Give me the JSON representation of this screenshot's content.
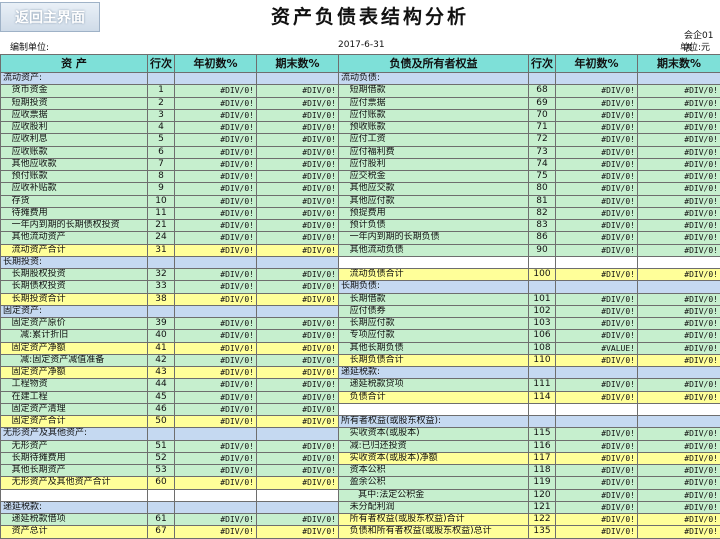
{
  "nav": {
    "back_label": "返回主界面"
  },
  "header": {
    "title": "资产负债表结构分析",
    "form_code": "会企01表",
    "unit_label": "编制单位:",
    "date": "2017-6-31",
    "currency_unit": "单位:元"
  },
  "columns": [
    "资  产",
    "行次",
    "年初数%",
    "期末数%",
    "负债及所有者权益",
    "行次",
    "年初数%",
    "期末数%"
  ],
  "colors": {
    "header": "#7ee0d8",
    "row_green": "#c6efce",
    "row_yellow": "#ffff99",
    "row_blue": "#c5d9f1"
  },
  "rows": [
    {
      "s": "blue",
      "a": "流动资产:",
      "an": "",
      "ab": "",
      "ae": "",
      "ls": "blue",
      "l": "流动负债:",
      "ln": "",
      "lb": "",
      "le": ""
    },
    {
      "s": "green",
      "a": "   货币资金",
      "an": "1",
      "ab": "#DIV/0!",
      "ae": "#DIV/0!",
      "ls": "green",
      "l": "   短期借款",
      "ln": "68",
      "lb": "#DIV/0!",
      "le": "#DIV/0!"
    },
    {
      "s": "green",
      "a": "   短期投资",
      "an": "2",
      "ab": "#DIV/0!",
      "ae": "#DIV/0!",
      "ls": "green",
      "l": "   应付票据",
      "ln": "69",
      "lb": "#DIV/0!",
      "le": "#DIV/0!"
    },
    {
      "s": "green",
      "a": "   应收票据",
      "an": "3",
      "ab": "#DIV/0!",
      "ae": "#DIV/0!",
      "ls": "green",
      "l": "   应付账款",
      "ln": "70",
      "lb": "#DIV/0!",
      "le": "#DIV/0!"
    },
    {
      "s": "green",
      "a": "   应收股利",
      "an": "4",
      "ab": "#DIV/0!",
      "ae": "#DIV/0!",
      "ls": "green",
      "l": "   预收账款",
      "ln": "71",
      "lb": "#DIV/0!",
      "le": "#DIV/0!"
    },
    {
      "s": "green",
      "a": "   应收利息",
      "an": "5",
      "ab": "#DIV/0!",
      "ae": "#DIV/0!",
      "ls": "green",
      "l": "   应付工资",
      "ln": "72",
      "lb": "#DIV/0!",
      "le": "#DIV/0!"
    },
    {
      "s": "green",
      "a": "   应收账款",
      "an": "6",
      "ab": "#DIV/0!",
      "ae": "#DIV/0!",
      "ls": "green",
      "l": "   应付福利费",
      "ln": "73",
      "lb": "#DIV/0!",
      "le": "#DIV/0!"
    },
    {
      "s": "green",
      "a": "   其他应收款",
      "an": "7",
      "ab": "#DIV/0!",
      "ae": "#DIV/0!",
      "ls": "green",
      "l": "   应付股利",
      "ln": "74",
      "lb": "#DIV/0!",
      "le": "#DIV/0!"
    },
    {
      "s": "green",
      "a": "   预付账款",
      "an": "8",
      "ab": "#DIV/0!",
      "ae": "#DIV/0!",
      "ls": "green",
      "l": "   应交税金",
      "ln": "75",
      "lb": "#DIV/0!",
      "le": "#DIV/0!"
    },
    {
      "s": "green",
      "a": "   应收补贴款",
      "an": "9",
      "ab": "#DIV/0!",
      "ae": "#DIV/0!",
      "ls": "green",
      "l": "   其他应交款",
      "ln": "80",
      "lb": "#DIV/0!",
      "le": "#DIV/0!"
    },
    {
      "s": "green",
      "a": "   存货",
      "an": "10",
      "ab": "#DIV/0!",
      "ae": "#DIV/0!",
      "ls": "green",
      "l": "   其他应付款",
      "ln": "81",
      "lb": "#DIV/0!",
      "le": "#DIV/0!"
    },
    {
      "s": "green",
      "a": "   待摊费用",
      "an": "11",
      "ab": "#DIV/0!",
      "ae": "#DIV/0!",
      "ls": "green",
      "l": "   预提费用",
      "ln": "82",
      "lb": "#DIV/0!",
      "le": "#DIV/0!"
    },
    {
      "s": "green",
      "a": "   一年内到期的长期债权投资",
      "an": "21",
      "ab": "#DIV/0!",
      "ae": "#DIV/0!",
      "ls": "green",
      "l": "   预计负债",
      "ln": "83",
      "lb": "#DIV/0!",
      "le": "#DIV/0!"
    },
    {
      "s": "green",
      "a": "   其他流动资产",
      "an": "24",
      "ab": "#DIV/0!",
      "ae": "#DIV/0!",
      "ls": "green",
      "l": "   一年内到期的长期负债",
      "ln": "86",
      "lb": "#DIV/0!",
      "le": "#DIV/0!"
    },
    {
      "s": "yellow",
      "a": "   流动资产合计",
      "an": "31",
      "ab": "#DIV/0!",
      "ae": "#DIV/0!",
      "ls": "green",
      "l": "   其他流动负债",
      "ln": "90",
      "lb": "#DIV/0!",
      "le": "#DIV/0!"
    },
    {
      "s": "blue",
      "a": "长期投资:",
      "an": "",
      "ab": "",
      "ae": "",
      "ls": "white",
      "l": "",
      "ln": "",
      "lb": "",
      "le": ""
    },
    {
      "s": "green",
      "a": "   长期股权投资",
      "an": "32",
      "ab": "#DIV/0!",
      "ae": "#DIV/0!",
      "ls": "yellow",
      "l": "   流动负债合计",
      "ln": "100",
      "lb": "#DIV/0!",
      "le": "#DIV/0!"
    },
    {
      "s": "green",
      "a": "   长期债权投资",
      "an": "33",
      "ab": "#DIV/0!",
      "ae": "#DIV/0!",
      "ls": "blue",
      "l": "长期负债:",
      "ln": "",
      "lb": "",
      "le": ""
    },
    {
      "s": "yellow",
      "a": "   长期投资合计",
      "an": "38",
      "ab": "#DIV/0!",
      "ae": "#DIV/0!",
      "ls": "green",
      "l": "   长期借款",
      "ln": "101",
      "lb": "#DIV/0!",
      "le": "#DIV/0!"
    },
    {
      "s": "blue",
      "a": "固定资产:",
      "an": "",
      "ab": "",
      "ae": "",
      "ls": "green",
      "l": "   应付债券",
      "ln": "102",
      "lb": "#DIV/0!",
      "le": "#DIV/0!"
    },
    {
      "s": "green",
      "a": "   固定资产原价",
      "an": "39",
      "ab": "#DIV/0!",
      "ae": "#DIV/0!",
      "ls": "green",
      "l": "   长期应付款",
      "ln": "103",
      "lb": "#DIV/0!",
      "le": "#DIV/0!"
    },
    {
      "s": "green",
      "a": "      减:累计折旧",
      "an": "40",
      "ab": "#DIV/0!",
      "ae": "#DIV/0!",
      "ls": "green",
      "l": "   专项应付款",
      "ln": "106",
      "lb": "#DIV/0!",
      "le": "#DIV/0!"
    },
    {
      "s": "yellow",
      "a": "   固定资产净额",
      "an": "41",
      "ab": "#DIV/0!",
      "ae": "#DIV/0!",
      "ls": "green",
      "l": "   其他长期负债",
      "ln": "108",
      "lb": "#VALUE!",
      "le": "#DIV/0!"
    },
    {
      "s": "green",
      "a": "      减:固定资产减值准备",
      "an": "42",
      "ab": "#DIV/0!",
      "ae": "#DIV/0!",
      "ls": "yellow",
      "l": "   长期负债合计",
      "ln": "110",
      "lb": "#DIV/0!",
      "le": "#DIV/0!"
    },
    {
      "s": "yellow",
      "a": "   固定资产净额",
      "an": "43",
      "ab": "#DIV/0!",
      "ae": "#DIV/0!",
      "ls": "blue",
      "l": "递延税款:",
      "ln": "",
      "lb": "",
      "le": ""
    },
    {
      "s": "green",
      "a": "   工程物资",
      "an": "44",
      "ab": "#DIV/0!",
      "ae": "#DIV/0!",
      "ls": "green",
      "l": "   递延税款贷项",
      "ln": "111",
      "lb": "#DIV/0!",
      "le": "#DIV/0!"
    },
    {
      "s": "green",
      "a": "   在建工程",
      "an": "45",
      "ab": "#DIV/0!",
      "ae": "#DIV/0!",
      "ls": "yellow",
      "l": "   负债合计",
      "ln": "114",
      "lb": "#DIV/0!",
      "le": "#DIV/0!"
    },
    {
      "s": "green",
      "a": "   固定资产清理",
      "an": "46",
      "ab": "#DIV/0!",
      "ae": "#DIV/0!",
      "ls": "white",
      "l": "",
      "ln": "",
      "lb": "",
      "le": ""
    },
    {
      "s": "yellow",
      "a": "   固定资产合计",
      "an": "50",
      "ab": "#DIV/0!",
      "ae": "#DIV/0!",
      "ls": "blue",
      "l": "所有者权益(或股东权益):",
      "ln": "",
      "lb": "",
      "le": ""
    },
    {
      "s": "blue",
      "a": "无形资产及其他资产:",
      "an": "",
      "ab": "",
      "ae": "",
      "ls": "green",
      "l": "   实收资本(或股本)",
      "ln": "115",
      "lb": "#DIV/0!",
      "le": "#DIV/0!"
    },
    {
      "s": "green",
      "a": "   无形资产",
      "an": "51",
      "ab": "#DIV/0!",
      "ae": "#DIV/0!",
      "ls": "green",
      "l": "   减:已归还投资",
      "ln": "116",
      "lb": "#DIV/0!",
      "le": "#DIV/0!"
    },
    {
      "s": "green",
      "a": "   长期待摊费用",
      "an": "52",
      "ab": "#DIV/0!",
      "ae": "#DIV/0!",
      "ls": "yellow",
      "l": "   实收资本(或股本)净额",
      "ln": "117",
      "lb": "#DIV/0!",
      "le": "#DIV/0!"
    },
    {
      "s": "green",
      "a": "   其他长期资产",
      "an": "53",
      "ab": "#DIV/0!",
      "ae": "#DIV/0!",
      "ls": "green",
      "l": "   资本公积",
      "ln": "118",
      "lb": "#DIV/0!",
      "le": "#DIV/0!"
    },
    {
      "s": "yellow",
      "a": "   无形资产及其他资产合计",
      "an": "60",
      "ab": "#DIV/0!",
      "ae": "#DIV/0!",
      "ls": "green",
      "l": "   盈余公积",
      "ln": "119",
      "lb": "#DIV/0!",
      "le": "#DIV/0!"
    },
    {
      "s": "white",
      "a": "",
      "an": "",
      "ab": "",
      "ae": "",
      "ls": "green",
      "l": "      其中:法定公积金",
      "ln": "120",
      "lb": "#DIV/0!",
      "le": "#DIV/0!"
    },
    {
      "s": "blue",
      "a": "递延税款:",
      "an": "",
      "ab": "",
      "ae": "",
      "ls": "green",
      "l": "   未分配利润",
      "ln": "121",
      "lb": "#DIV/0!",
      "le": "#DIV/0!"
    },
    {
      "s": "green",
      "a": "   递延税款借项",
      "an": "61",
      "ab": "#DIV/0!",
      "ae": "#DIV/0!",
      "ls": "yellow",
      "l": "   所有者权益(或股东权益)合计",
      "ln": "122",
      "lb": "#DIV/0!",
      "le": "#DIV/0!"
    },
    {
      "s": "yellow",
      "a": "   资产总计",
      "an": "67",
      "ab": "#DIV/0!",
      "ae": "#DIV/0!",
      "ls": "yellow",
      "l": "   负债和所有者权益(或股东权益)总计",
      "ln": "135",
      "lb": "#DIV/0!",
      "le": "#DIV/0!"
    }
  ]
}
